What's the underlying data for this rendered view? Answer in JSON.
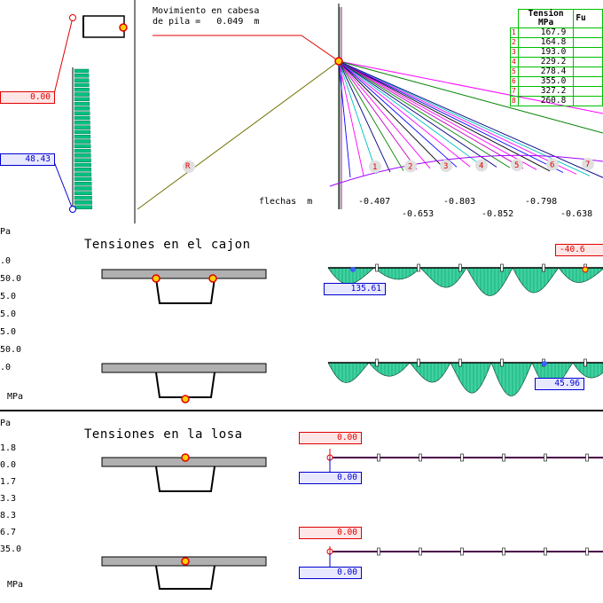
{
  "top": {
    "movement_label_1": "Movimiento en cabesa",
    "movement_label_2": "de pila =",
    "movement_value": "0.049",
    "movement_unit": "m",
    "left_red_value": "0.00",
    "left_blue_value": "48.43",
    "anchor_marker": "R",
    "flechas_label": "flechas",
    "flechas_unit": "m",
    "deflections_row1": [
      "-0.407",
      "-0.803",
      "-0.798"
    ],
    "deflections_row2": [
      "-0.653",
      "-0.852",
      "-0.638"
    ],
    "cable_numbers": [
      "1",
      "2",
      "3",
      "4",
      "5",
      "6",
      "7"
    ],
    "table": {
      "header_1": "Tension",
      "header_2": "MPa",
      "header_3": "Fu",
      "rows": [
        {
          "n": "1",
          "v": "167.9"
        },
        {
          "n": "2",
          "v": "164.8"
        },
        {
          "n": "3",
          "v": "193.0"
        },
        {
          "n": "4",
          "v": "229.2"
        },
        {
          "n": "5",
          "v": "278.4"
        },
        {
          "n": "6",
          "v": "355.0"
        },
        {
          "n": "7",
          "v": "327.2"
        },
        {
          "n": "8",
          "v": "260.8"
        }
      ]
    }
  },
  "cajon": {
    "title": "Tensiones en el cajon",
    "unit_top": "Pa",
    "unit_bottom": "MPa",
    "axis_values": [
      ".0",
      "50.0",
      "5.0",
      "5.0",
      "5.0",
      "50.0",
      ".0"
    ],
    "top_red_value": "-40.6",
    "top_blue_value": "135.61",
    "bottom_blue_value": "45.96"
  },
  "losa": {
    "title": "Tensiones en la losa",
    "unit_top": "Pa",
    "unit_bottom": "MPa",
    "axis_values": [
      "1.8",
      "0.0",
      "1.7",
      "3.3",
      "8.3",
      "6.7",
      "35.0"
    ],
    "top_red_value": "0.00",
    "top_blue_value": "0.00",
    "bottom_red_value": "0.00",
    "bottom_blue_value": "0.00"
  },
  "colors": {
    "stress_fill": "#00c080",
    "red": "#e00000",
    "blue": "#0000d0",
    "table_border": "#00c000"
  }
}
